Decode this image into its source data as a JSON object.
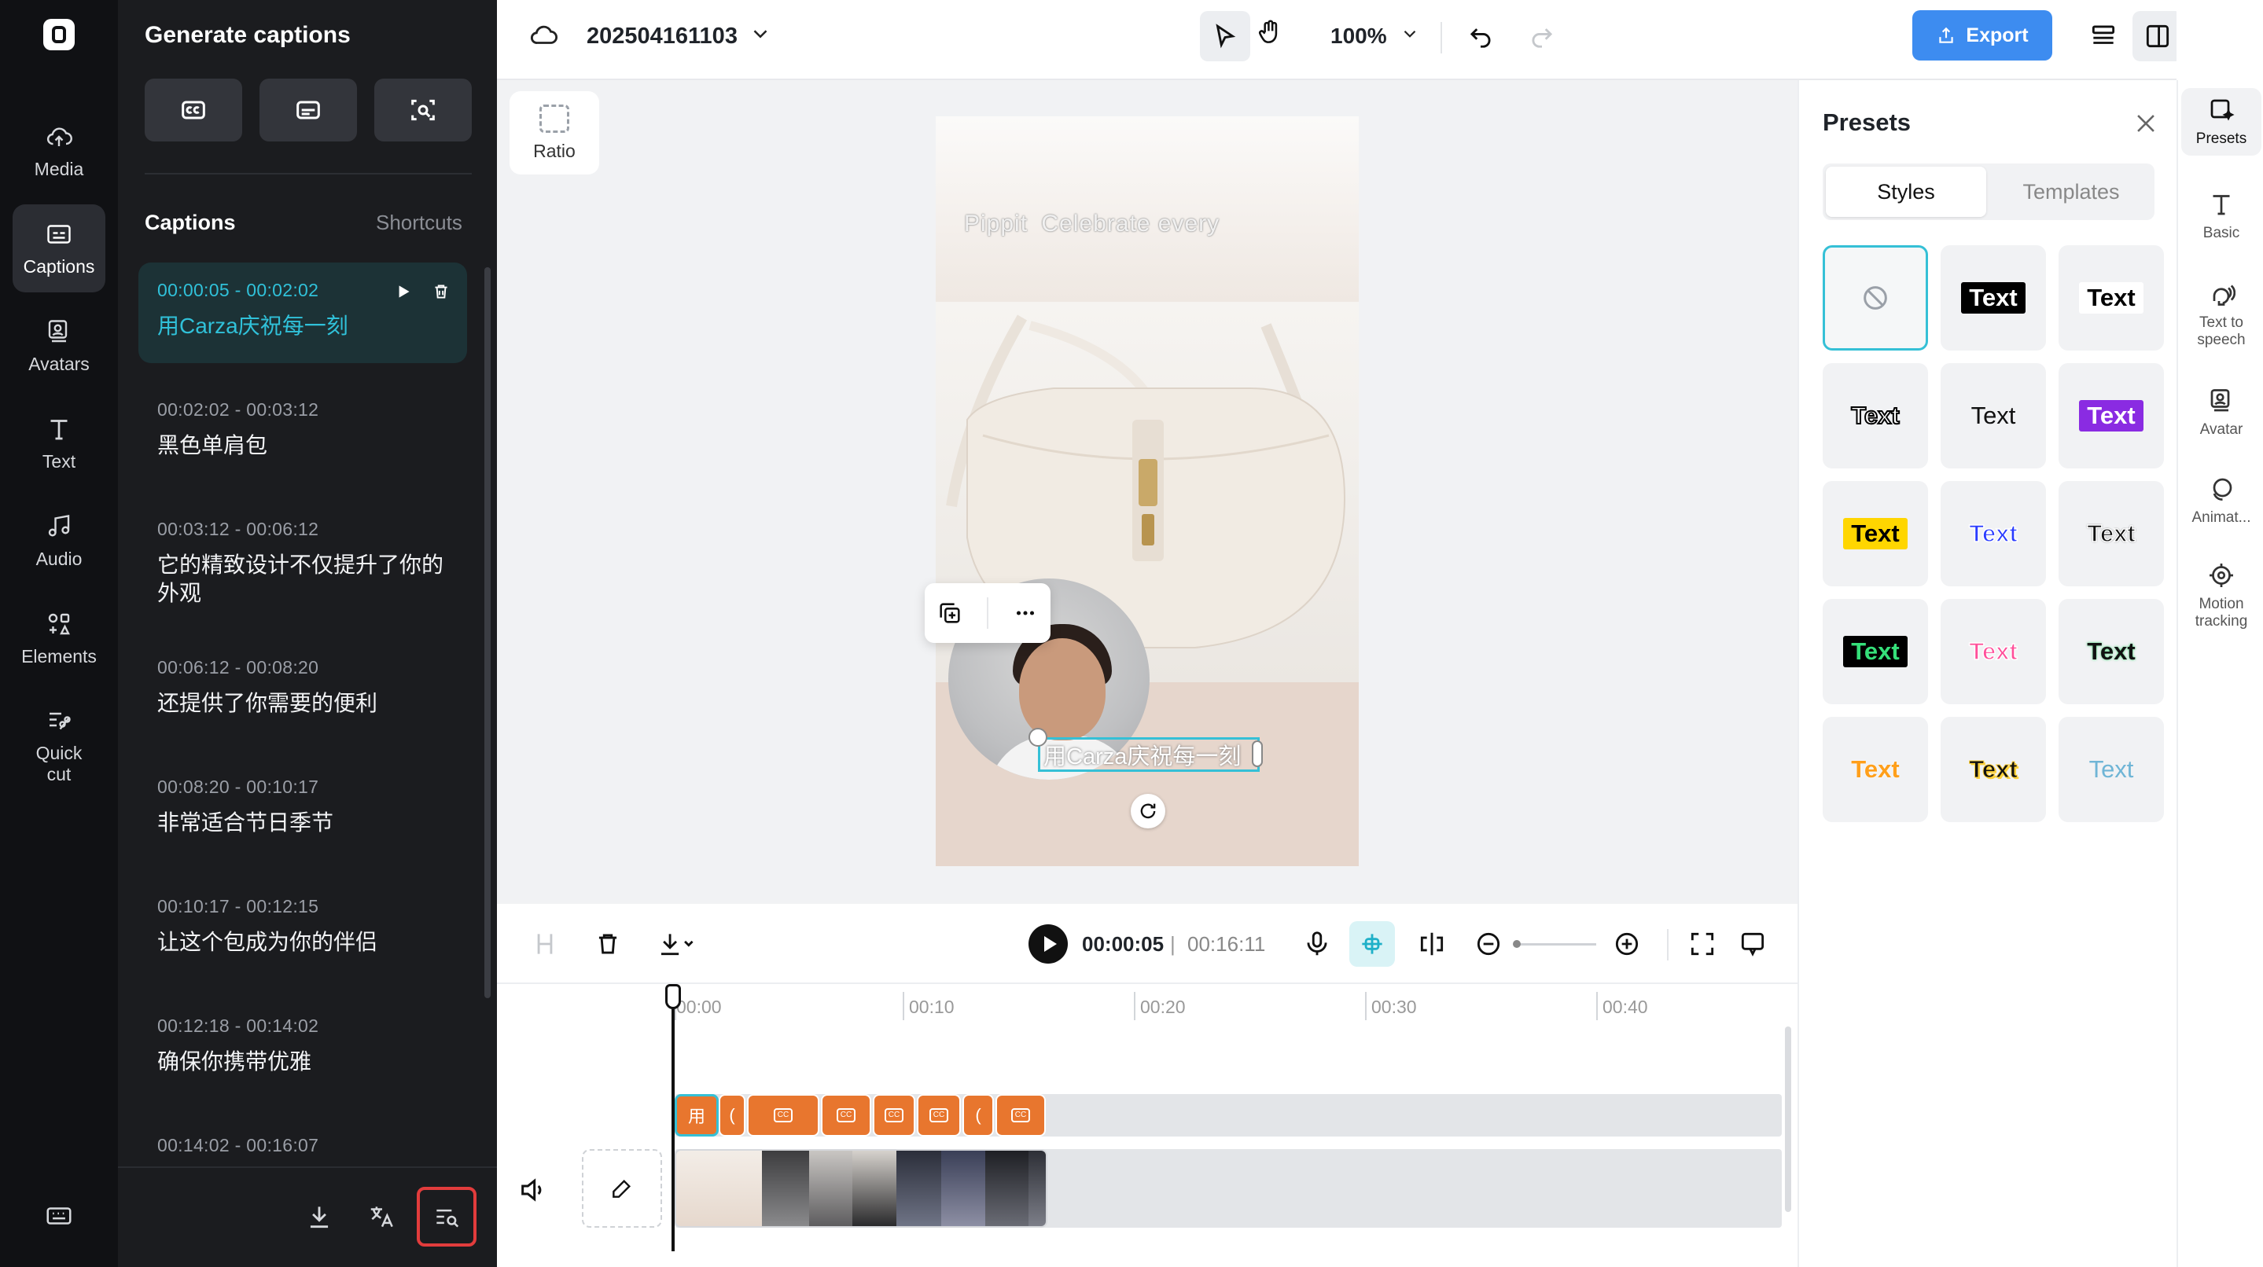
{
  "rail": {
    "items": [
      {
        "label": "Media",
        "icon": "cloud-upload-icon"
      },
      {
        "label": "Captions",
        "icon": "captions-icon",
        "active": true
      },
      {
        "label": "Avatars",
        "icon": "avatar-icon"
      },
      {
        "label": "Text",
        "icon": "text-icon"
      },
      {
        "label": "Audio",
        "icon": "music-note-icon"
      },
      {
        "label": "Elements",
        "icon": "elements-icon"
      },
      {
        "label": "Quick\ncut",
        "icon": "quick-cut-icon"
      }
    ]
  },
  "captions_panel": {
    "title": "Generate captions",
    "list_header": "Captions",
    "shortcuts_label": "Shortcuts",
    "items": [
      {
        "time": "00:00:05 - 00:02:02",
        "text": "用Carza庆祝每一刻",
        "active": true
      },
      {
        "time": "00:02:02 - 00:03:12",
        "text": "黑色单肩包"
      },
      {
        "time": "00:03:12 - 00:06:12",
        "text": "它的精致设计不仅提升了你的外观"
      },
      {
        "time": "00:06:12 - 00:08:20",
        "text": "还提供了你需要的便利"
      },
      {
        "time": "00:08:20 - 00:10:17",
        "text": "非常适合节日季节"
      },
      {
        "time": "00:10:17 - 00:12:15",
        "text": "让这个包成为你的伴侣"
      },
      {
        "time": "00:12:18 - 00:14:02",
        "text": "确保你携带优雅"
      },
      {
        "time": "00:14:02 - 00:16:07",
        "text": ""
      }
    ]
  },
  "topbar": {
    "project_name": "202504161103",
    "zoom": "100%",
    "export_label": "Export"
  },
  "stage": {
    "ratio_label": "Ratio",
    "overlay_text_left": "Pippit",
    "overlay_text_right": "Celebrate every",
    "caption_text": "用Carza庆祝每一刻"
  },
  "timeline": {
    "current_time": "00:00:05",
    "separator": "|",
    "total_time": "00:16:11",
    "ruler": [
      "00:00",
      "00:10",
      "00:20",
      "00:30",
      "00:40"
    ],
    "first_clip_label": "用"
  },
  "presets": {
    "title": "Presets",
    "tabs": [
      "Styles",
      "Templates"
    ],
    "tile_text": "Text"
  },
  "right_rail": {
    "items": [
      "Presets",
      "Basic",
      "Text to speech",
      "Avatar",
      "Animat...",
      "Motion tracking"
    ]
  },
  "colors": {
    "accent": "#35c0d6",
    "export": "#3d8cf0",
    "clip": "#e8762e",
    "highlight_border": "#e23c3c"
  }
}
